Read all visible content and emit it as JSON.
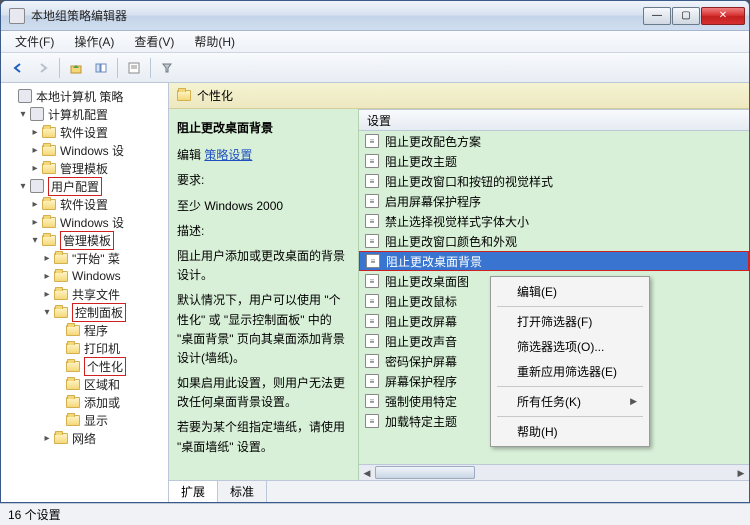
{
  "window": {
    "title": "本地组策略编辑器"
  },
  "menu": {
    "file": "文件(F)",
    "action": "操作(A)",
    "view": "查看(V)",
    "help": "帮助(H)"
  },
  "tree": [
    {
      "ind": 0,
      "exp": "",
      "icon": "special",
      "label": "本地计算机 策略",
      "hl": false
    },
    {
      "ind": 1,
      "exp": "▾",
      "icon": "special",
      "label": "计算机配置",
      "hl": false
    },
    {
      "ind": 2,
      "exp": "▸",
      "icon": "folder",
      "label": "软件设置",
      "hl": false
    },
    {
      "ind": 2,
      "exp": "▸",
      "icon": "folder",
      "label": "Windows 设",
      "hl": false
    },
    {
      "ind": 2,
      "exp": "▸",
      "icon": "folder",
      "label": "管理模板",
      "hl": false
    },
    {
      "ind": 1,
      "exp": "▾",
      "icon": "special",
      "label": "用户配置",
      "hl": true
    },
    {
      "ind": 2,
      "exp": "▸",
      "icon": "folder",
      "label": "软件设置",
      "hl": false
    },
    {
      "ind": 2,
      "exp": "▸",
      "icon": "folder",
      "label": "Windows 设",
      "hl": false
    },
    {
      "ind": 2,
      "exp": "▾",
      "icon": "folder",
      "label": "管理模板",
      "hl": true
    },
    {
      "ind": 3,
      "exp": "▸",
      "icon": "folder",
      "label": "\"开始\" 菜",
      "hl": false
    },
    {
      "ind": 3,
      "exp": "▸",
      "icon": "folder",
      "label": "Windows",
      "hl": false
    },
    {
      "ind": 3,
      "exp": "▸",
      "icon": "folder",
      "label": "共享文件",
      "hl": false
    },
    {
      "ind": 3,
      "exp": "▾",
      "icon": "folder",
      "label": "控制面板",
      "hl": true
    },
    {
      "ind": 4,
      "exp": "",
      "icon": "folder",
      "label": "程序",
      "hl": false
    },
    {
      "ind": 4,
      "exp": "",
      "icon": "folder",
      "label": "打印机",
      "hl": false
    },
    {
      "ind": 4,
      "exp": "",
      "icon": "folder",
      "label": "个性化",
      "hl": true
    },
    {
      "ind": 4,
      "exp": "",
      "icon": "folder",
      "label": "区域和",
      "hl": false
    },
    {
      "ind": 4,
      "exp": "",
      "icon": "folder",
      "label": "添加或",
      "hl": false
    },
    {
      "ind": 4,
      "exp": "",
      "icon": "folder",
      "label": "显示",
      "hl": false
    },
    {
      "ind": 3,
      "exp": "▸",
      "icon": "folder",
      "label": "网络",
      "hl": false
    }
  ],
  "content": {
    "header": "个性化",
    "desc": {
      "title": "阻止更改桌面背景",
      "edit_label": "编辑",
      "edit_link": "策略设置",
      "req_label": "要求:",
      "req_text": "至少 Windows 2000",
      "desc_label": "描述:",
      "d1": "阻止用户添加或更改桌面的背景设计。",
      "d2": "默认情况下，用户可以使用 \"个性化\" 或 \"显示控制面板\" 中的 \"桌面背景\" 页向其桌面添加背景设计(墙纸)。",
      "d3": "如果启用此设置，则用户无法更改任何桌面背景设置。",
      "d4": "若要为某个组指定墙纸，请使用 \"桌面墙纸\" 设置。"
    },
    "list_header": "设置",
    "items": [
      {
        "label": "阻止更改配色方案",
        "sel": false,
        "clip": false
      },
      {
        "label": "阻止更改主题",
        "sel": false,
        "clip": false
      },
      {
        "label": "阻止更改窗口和按钮的视觉样式",
        "sel": false,
        "clip": false
      },
      {
        "label": "启用屏幕保护程序",
        "sel": false,
        "clip": false
      },
      {
        "label": "禁止选择视觉样式字体大小",
        "sel": false,
        "clip": false
      },
      {
        "label": "阻止更改窗口颜色和外观",
        "sel": false,
        "clip": false
      },
      {
        "label": "阻止更改桌面背景",
        "sel": true,
        "clip": false
      },
      {
        "label": "阻止更改桌面图",
        "sel": false,
        "clip": true
      },
      {
        "label": "阻止更改鼠标",
        "sel": false,
        "clip": true
      },
      {
        "label": "阻止更改屏幕",
        "sel": false,
        "clip": true
      },
      {
        "label": "阻止更改声音",
        "sel": false,
        "clip": true
      },
      {
        "label": "密码保护屏幕",
        "sel": false,
        "clip": true
      },
      {
        "label": "屏幕保护程序",
        "sel": false,
        "clip": true
      },
      {
        "label": "强制使用特定",
        "sel": false,
        "clip": true
      },
      {
        "label": "加载特定主题",
        "sel": false,
        "clip": true
      }
    ],
    "tabs": {
      "ext": "扩展",
      "std": "标准"
    }
  },
  "context": [
    {
      "label": "编辑(E)",
      "sub": false
    },
    {
      "sep": true
    },
    {
      "label": "打开筛选器(F)",
      "sub": false
    },
    {
      "label": "筛选器选项(O)...",
      "sub": false
    },
    {
      "label": "重新应用筛选器(E)",
      "sub": false
    },
    {
      "sep": true
    },
    {
      "label": "所有任务(K)",
      "sub": true
    },
    {
      "sep": true
    },
    {
      "label": "帮助(H)",
      "sub": false
    }
  ],
  "status": "16 个设置"
}
